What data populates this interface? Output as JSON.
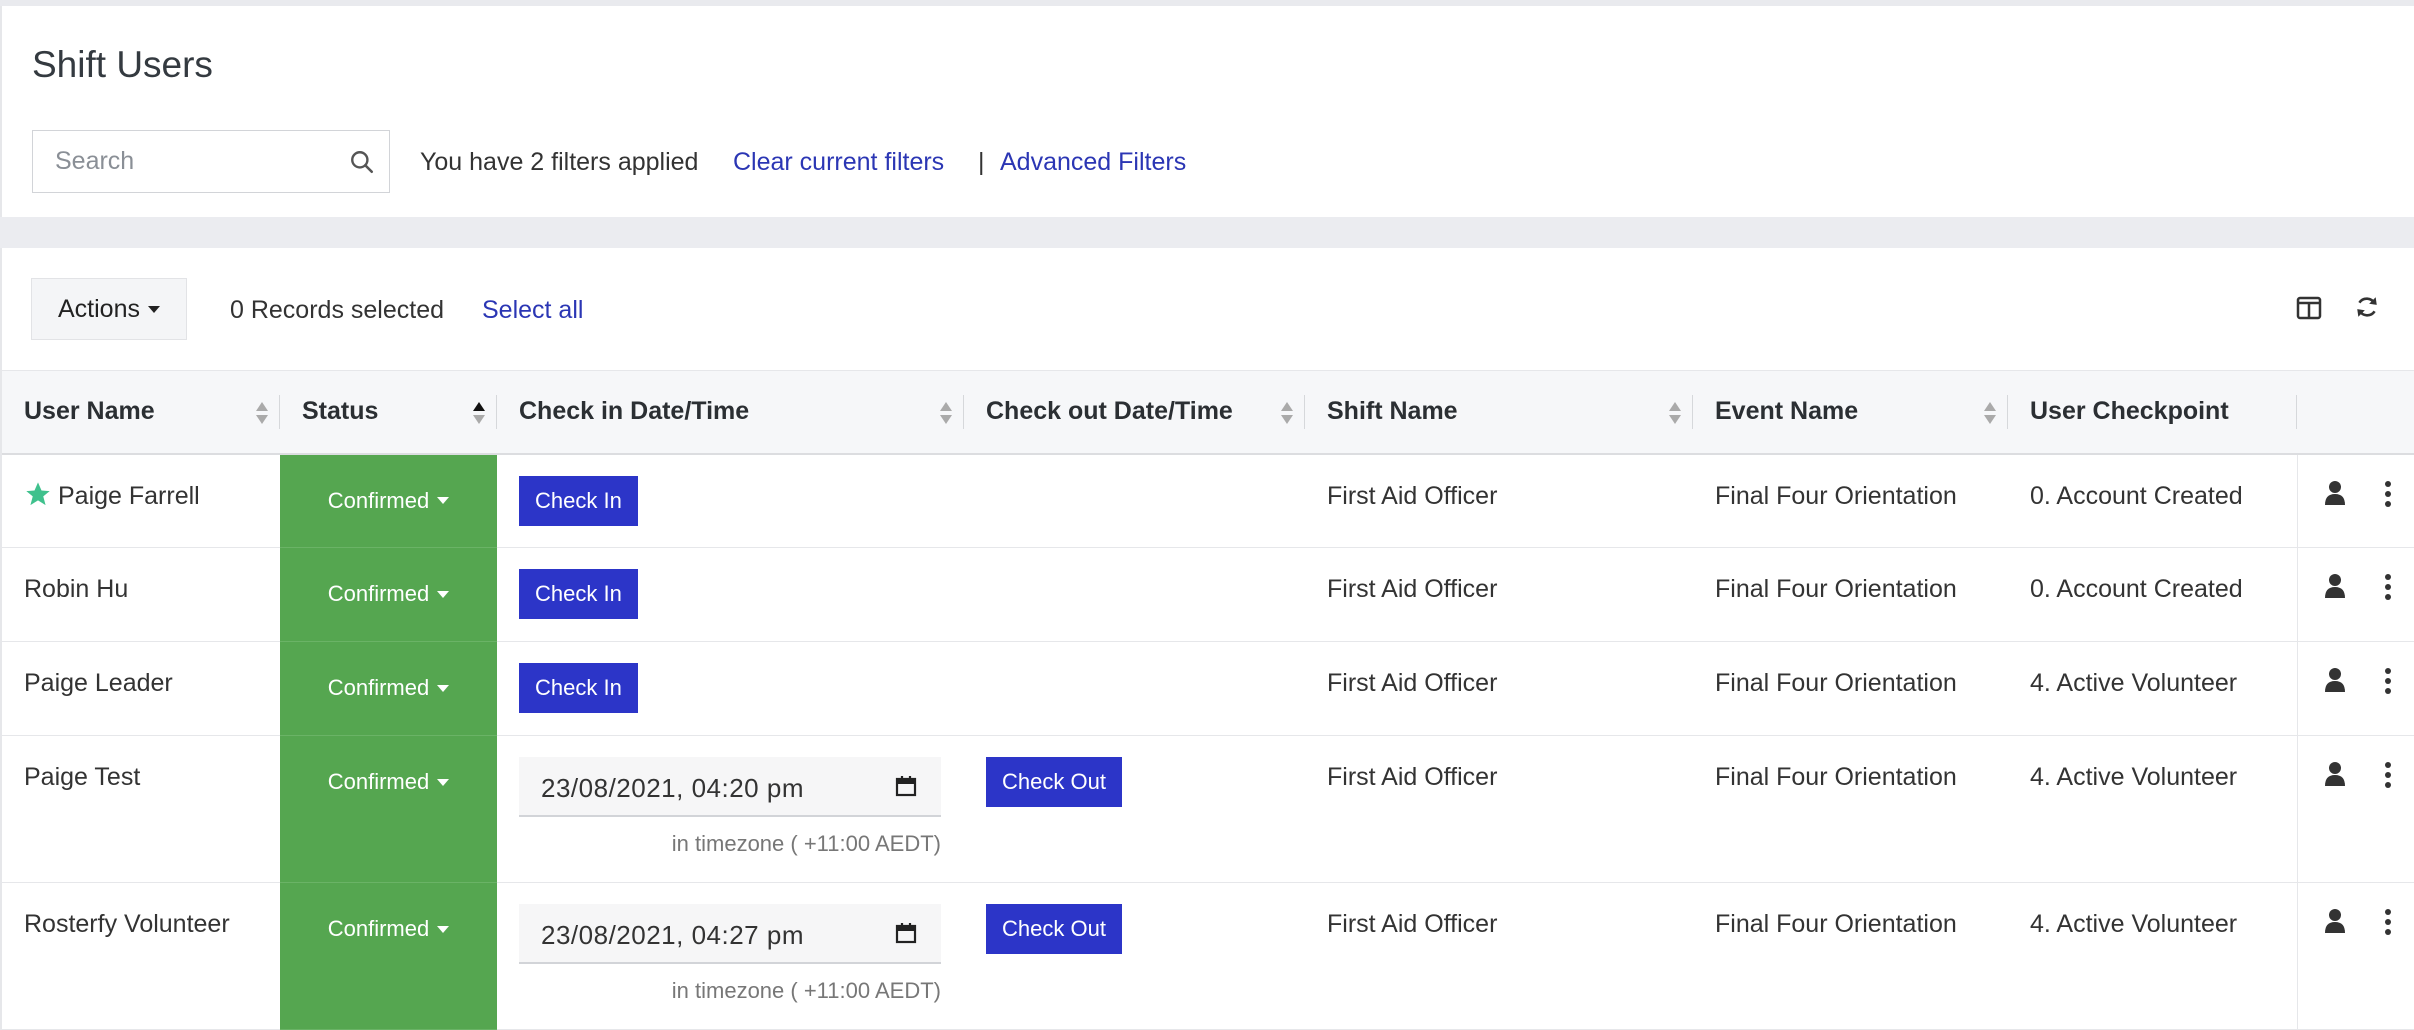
{
  "page": {
    "title": "Shift Users"
  },
  "search": {
    "placeholder": "Search",
    "icon": "search-icon"
  },
  "filters": {
    "status_text": "You have 2 filters applied",
    "clear_label": "Clear current filters",
    "separator": "|",
    "advanced_label": "Advanced Filters"
  },
  "toolbar": {
    "actions_label": "Actions",
    "records_selected": "0 Records selected",
    "select_all_label": "Select all",
    "icons": [
      "columns-icon",
      "refresh-icon"
    ]
  },
  "table": {
    "columns": [
      {
        "label": "User Name",
        "sortable": true
      },
      {
        "label": "Status",
        "sortable": true,
        "sort": "ascending"
      },
      {
        "label": "Check in Date/Time",
        "sortable": true
      },
      {
        "label": "Check out Date/Time",
        "sortable": true
      },
      {
        "label": "Shift Name",
        "sortable": true
      },
      {
        "label": "Event Name",
        "sortable": true
      },
      {
        "label": "User Checkpoint",
        "sortable": false
      }
    ],
    "rows": [
      {
        "user": "Paige Farrell",
        "starred": true,
        "status": "Confirmed",
        "check_in_label": "Check In",
        "check_in": null,
        "check_out_label": null,
        "shift": "First Aid Officer",
        "event": "Final Four Orientation",
        "checkpoint": "0. Account Created"
      },
      {
        "user": "Robin Hu",
        "starred": false,
        "status": "Confirmed",
        "check_in_label": "Check In",
        "check_in": null,
        "check_out_label": null,
        "shift": "First Aid Officer",
        "event": "Final Four Orientation",
        "checkpoint": "0. Account Created"
      },
      {
        "user": "Paige Leader",
        "starred": false,
        "status": "Confirmed",
        "check_in_label": "Check In",
        "check_in": null,
        "check_out_label": null,
        "shift": "First Aid Officer",
        "event": "Final Four Orientation",
        "checkpoint": "4. Active Volunteer"
      },
      {
        "user": "Paige Test",
        "starred": false,
        "status": "Confirmed",
        "check_in_label": null,
        "check_in": "23/08/2021, 04:20 pm",
        "timezone": "in timezone ( +11:00 AEDT)",
        "check_out_label": "Check Out",
        "shift": "First Aid Officer",
        "event": "Final Four Orientation",
        "checkpoint": "4. Active Volunteer"
      },
      {
        "user": "Rosterfy Volunteer",
        "starred": false,
        "status": "Confirmed",
        "check_in_label": null,
        "check_in": "23/08/2021, 04:27 pm",
        "timezone": "in timezone ( +11:00 AEDT)",
        "check_out_label": "Check Out",
        "shift": "First Aid Officer",
        "event": "Final Four Orientation",
        "checkpoint": "4. Active Volunteer"
      }
    ]
  },
  "colors": {
    "status_green": "#55a650",
    "button_blue": "#2c35c8",
    "link_blue": "#2b36b4",
    "star_green": "#3fc18d"
  }
}
